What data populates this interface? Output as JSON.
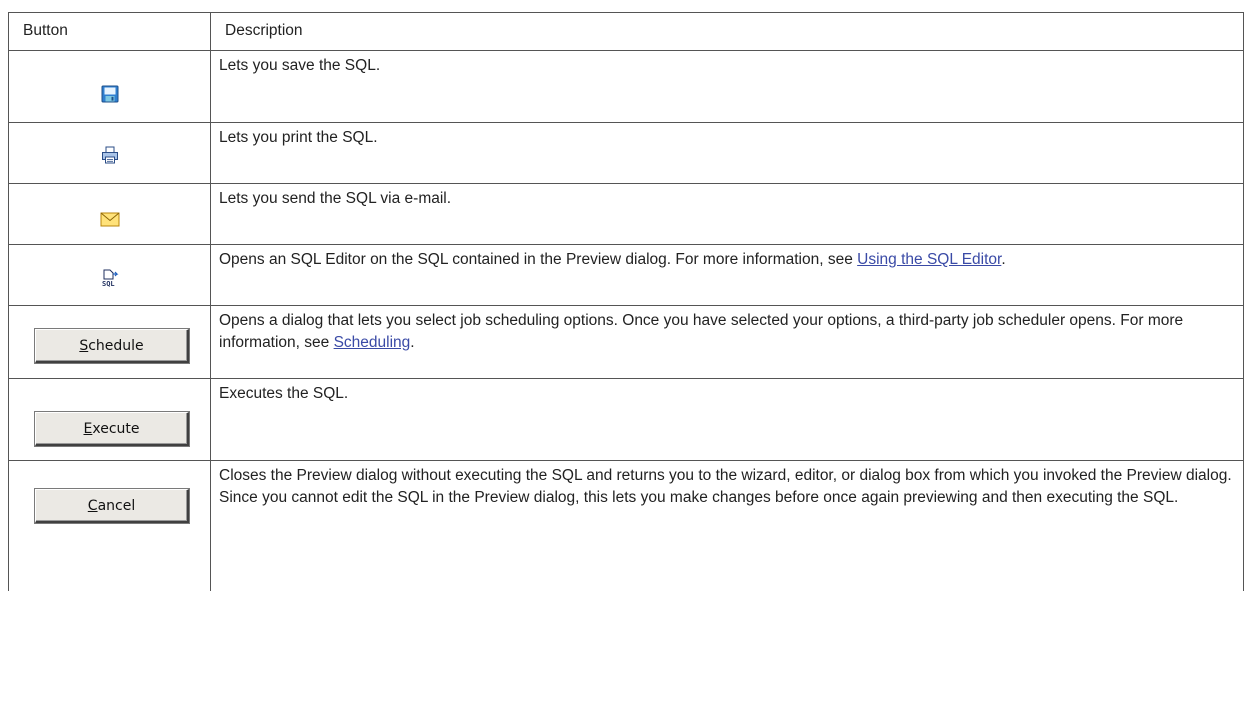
{
  "table": {
    "headers": [
      "Button",
      "Description"
    ],
    "rows": [
      {
        "icon": "save-icon",
        "label": "",
        "description": "Lets you save the SQL."
      },
      {
        "icon": "print-icon",
        "label": "",
        "description": "Lets you print the SQL."
      },
      {
        "icon": "email-icon",
        "label": "",
        "description": "Lets you send the SQL via e-mail."
      },
      {
        "icon": "sql-editor-icon",
        "label": "",
        "description": "Opens an SQL Editor on the SQL contained in the Preview dialog. For more information, see ",
        "link": "Using the SQL Editor",
        "suffix": "."
      },
      {
        "icon": "",
        "label_mnemonic": "S",
        "label_rest": "chedule",
        "description": "Opens a dialog that lets you select job scheduling options. Once you have selected your options, a third-party job scheduler opens. For more information, see ",
        "link": "Scheduling",
        "suffix": "."
      },
      {
        "icon": "",
        "label_mnemonic": "E",
        "label_rest": "xecute",
        "description": "Executes the SQL."
      },
      {
        "icon": "",
        "label_mnemonic": "C",
        "label_rest": "ancel",
        "description": "Closes the Preview dialog without executing the SQL and returns you to the wizard, editor, or dialog box from which you invoked the Preview dialog. Since you cannot edit the SQL in the Preview dialog, this lets you make changes before once again previewing and then executing the SQL."
      }
    ]
  },
  "colors": {
    "link": "#3a4aa6",
    "border": "#555555",
    "button_face": "#ebe9e4"
  }
}
